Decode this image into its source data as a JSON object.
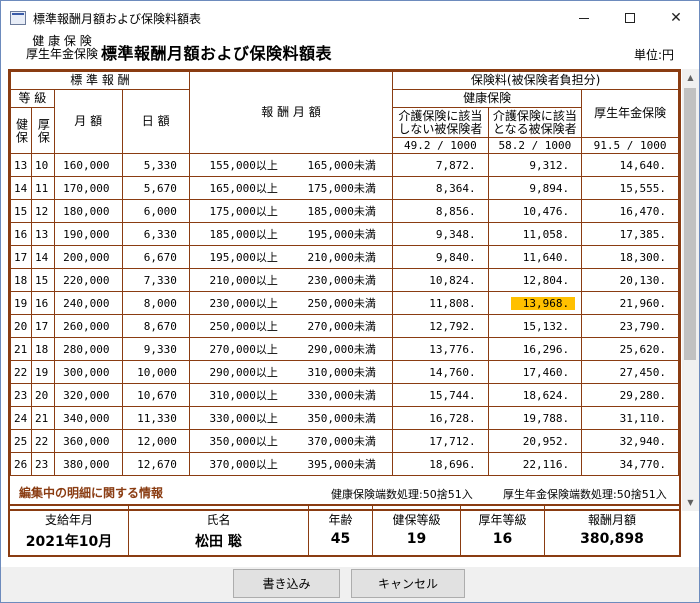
{
  "window": {
    "title": "標準報酬月額および保険料額表"
  },
  "header": {
    "sub_line1": "健 康 保 険",
    "sub_line2": "厚生年金保険",
    "title": "標準報酬月額および保険料額表",
    "unit": "単位:円"
  },
  "table_head": {
    "standard_remuneration": "標 準 報 酬",
    "grade": "等 級",
    "grade_health": "健保",
    "grade_pension": "厚保",
    "monthly": "月 額",
    "daily": "日 額",
    "remuneration_range": "報 酬 月 額",
    "premium": "保険料(被保険者負担分)",
    "health_insurance": "健康保険",
    "health_no_care_l1": "介護保険に該当",
    "health_no_care_l2": "しない被保険者",
    "health_care_l1": "介護保険に該当",
    "health_care_l2": "となる被保険者",
    "pension": "厚生年金保険",
    "rate_no_care": "49.2 / 1000",
    "rate_care": "58.2 / 1000",
    "rate_pension": "91.5 / 1000",
    "above": "以上",
    "below": "未満"
  },
  "rows": [
    {
      "g1": "13",
      "g2": "10",
      "monthly": "160,000",
      "daily": "5,330",
      "lo": "155,000",
      "hi": "165,000",
      "a": "7,872.",
      "b": "9,312.",
      "c": "14,640."
    },
    {
      "g1": "14",
      "g2": "11",
      "monthly": "170,000",
      "daily": "5,670",
      "lo": "165,000",
      "hi": "175,000",
      "a": "8,364.",
      "b": "9,894.",
      "c": "15,555."
    },
    {
      "g1": "15",
      "g2": "12",
      "monthly": "180,000",
      "daily": "6,000",
      "lo": "175,000",
      "hi": "185,000",
      "a": "8,856.",
      "b": "10,476.",
      "c": "16,470."
    },
    {
      "g1": "16",
      "g2": "13",
      "monthly": "190,000",
      "daily": "6,330",
      "lo": "185,000",
      "hi": "195,000",
      "a": "9,348.",
      "b": "11,058.",
      "c": "17,385."
    },
    {
      "g1": "17",
      "g2": "14",
      "monthly": "200,000",
      "daily": "6,670",
      "lo": "195,000",
      "hi": "210,000",
      "a": "9,840.",
      "b": "11,640.",
      "c": "18,300."
    },
    {
      "g1": "18",
      "g2": "15",
      "monthly": "220,000",
      "daily": "7,330",
      "lo": "210,000",
      "hi": "230,000",
      "a": "10,824.",
      "b": "12,804.",
      "c": "20,130."
    },
    {
      "g1": "19",
      "g2": "16",
      "monthly": "240,000",
      "daily": "8,000",
      "lo": "230,000",
      "hi": "250,000",
      "a": "11,808.",
      "b": "13,968.",
      "c": "21,960.",
      "highlight": true
    },
    {
      "g1": "20",
      "g2": "17",
      "monthly": "260,000",
      "daily": "8,670",
      "lo": "250,000",
      "hi": "270,000",
      "a": "12,792.",
      "b": "15,132.",
      "c": "23,790."
    },
    {
      "g1": "21",
      "g2": "18",
      "monthly": "280,000",
      "daily": "9,330",
      "lo": "270,000",
      "hi": "290,000",
      "a": "13,776.",
      "b": "16,296.",
      "c": "25,620."
    },
    {
      "g1": "22",
      "g2": "19",
      "monthly": "300,000",
      "daily": "10,000",
      "lo": "290,000",
      "hi": "310,000",
      "a": "14,760.",
      "b": "17,460.",
      "c": "27,450."
    },
    {
      "g1": "23",
      "g2": "20",
      "monthly": "320,000",
      "daily": "10,670",
      "lo": "310,000",
      "hi": "330,000",
      "a": "15,744.",
      "b": "18,624.",
      "c": "29,280."
    },
    {
      "g1": "24",
      "g2": "21",
      "monthly": "340,000",
      "daily": "11,330",
      "lo": "330,000",
      "hi": "350,000",
      "a": "16,728.",
      "b": "19,788.",
      "c": "31,110."
    },
    {
      "g1": "25",
      "g2": "22",
      "monthly": "360,000",
      "daily": "12,000",
      "lo": "350,000",
      "hi": "370,000",
      "a": "17,712.",
      "b": "20,952.",
      "c": "32,940."
    },
    {
      "g1": "26",
      "g2": "23",
      "monthly": "380,000",
      "daily": "12,670",
      "lo": "370,000",
      "hi": "395,000",
      "a": "18,696.",
      "b": "22,116.",
      "c": "34,770."
    }
  ],
  "footer": {
    "title": "編集中の明細に関する情報",
    "health_rounding": "健康保険端数処理:50捨51入",
    "pension_rounding": "厚生年金保険端数処理:50捨51入"
  },
  "detail": {
    "pay_month_label": "支給年月",
    "pay_month": "2021年10月",
    "name_label": "氏名",
    "name": "松田 聡",
    "age_label": "年齢",
    "age": "45",
    "health_grade_label": "健保等級",
    "health_grade": "19",
    "pension_grade_label": "厚年等級",
    "pension_grade": "16",
    "monthly_label": "報酬月額",
    "monthly": "380,898"
  },
  "buttons": {
    "write": "書き込み",
    "cancel": "キャンセル"
  },
  "colors": {
    "border": "#8a3c12",
    "highlight": "#ffc000"
  }
}
